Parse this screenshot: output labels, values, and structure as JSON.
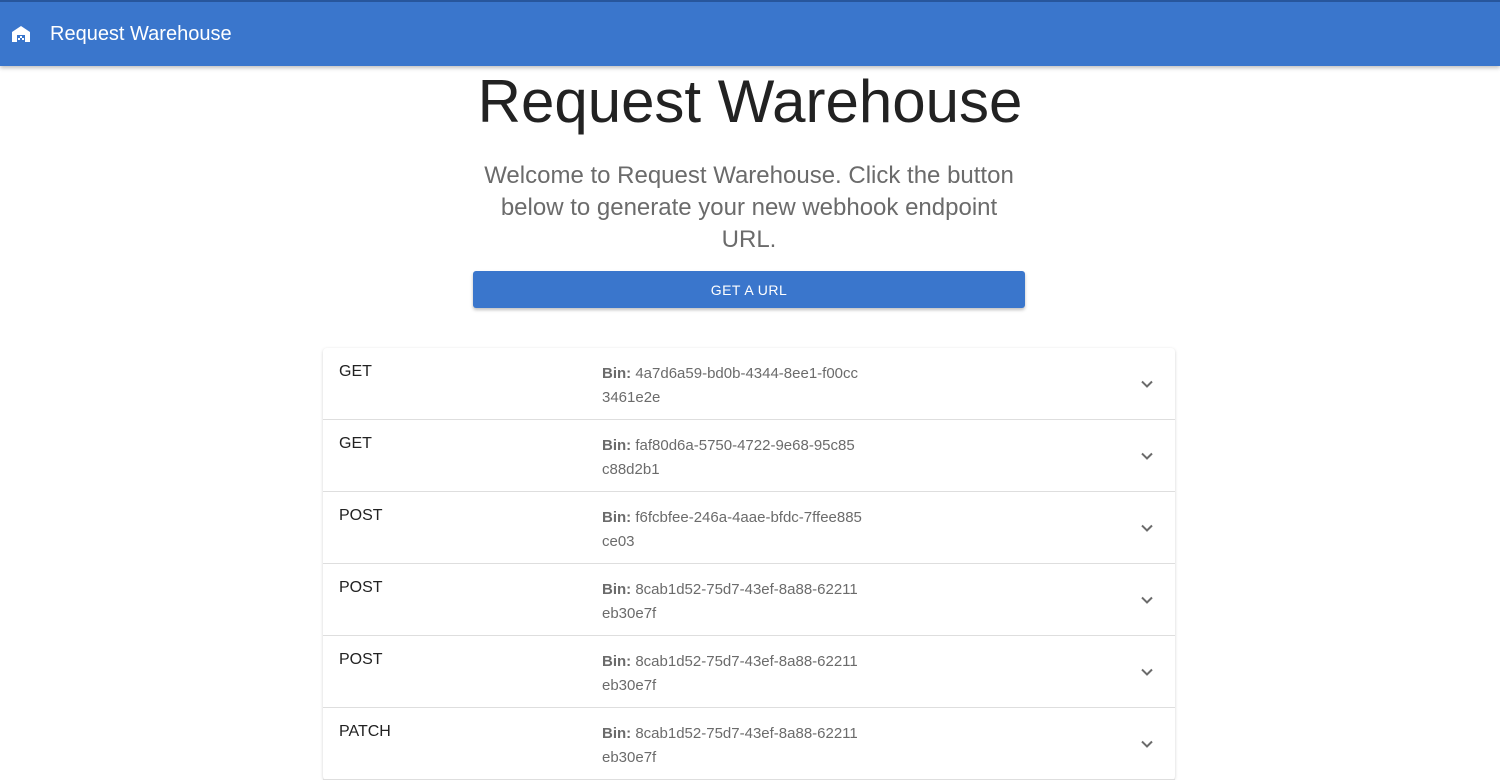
{
  "appbar": {
    "brand": "Request Warehouse",
    "logo_icon": "warehouse-icon",
    "color": "#3a76cc"
  },
  "hero": {
    "title": "Request Warehouse",
    "text": "Welcome to Request Warehouse. Click the button below to generate your new webhook endpoint URL.",
    "button_label": "GET A URL"
  },
  "requests": [
    {
      "method": "GET",
      "bin_label": "Bin:",
      "bin_id": "4a7d6a59-bd0b-4344-8ee1-f00cc3461e2e"
    },
    {
      "method": "GET",
      "bin_label": "Bin:",
      "bin_id": "faf80d6a-5750-4722-9e68-95c85c88d2b1"
    },
    {
      "method": "POST",
      "bin_label": "Bin:",
      "bin_id": "f6fcbfee-246a-4aae-bfdc-7ffee885ce03"
    },
    {
      "method": "POST",
      "bin_label": "Bin:",
      "bin_id": "8cab1d52-75d7-43ef-8a88-62211eb30e7f"
    },
    {
      "method": "POST",
      "bin_label": "Bin:",
      "bin_id": "8cab1d52-75d7-43ef-8a88-62211eb30e7f"
    },
    {
      "method": "PATCH",
      "bin_label": "Bin:",
      "bin_id": "8cab1d52-75d7-43ef-8a88-62211eb30e7f"
    }
  ]
}
